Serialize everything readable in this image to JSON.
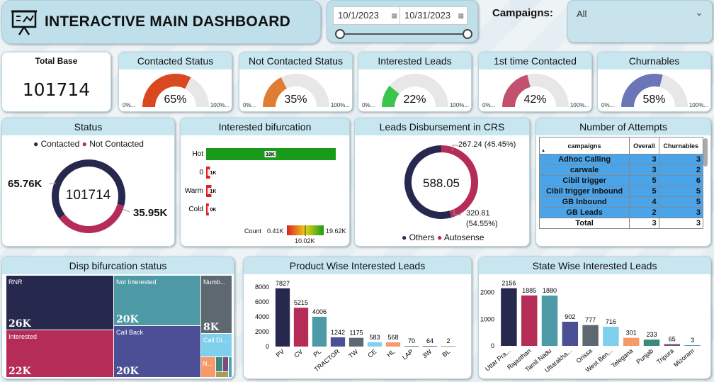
{
  "header": {
    "title": "INTERACTIVE MAIN DASHBOARD",
    "date_start": "10/1/2023",
    "date_end": "10/31/2023",
    "campaigns_label": "Campaigns:",
    "campaigns_value": "All",
    "slider_start_fraction": 0.0,
    "slider_end_fraction": 1.0
  },
  "kpis": {
    "total_base": {
      "title": "Total Base",
      "value": "101714"
    },
    "gauges": [
      {
        "title": "Contacted Status",
        "value_label": "65%",
        "value": 0.65,
        "color": "#d9481e",
        "min": "0%...",
        "max": "100%..."
      },
      {
        "title": "Not Contacted Status",
        "value_label": "35%",
        "value": 0.35,
        "color": "#e07d35",
        "min": "0%...",
        "max": "100%..."
      },
      {
        "title": "Interested Leads",
        "value_label": "22%",
        "value": 0.22,
        "color": "#3ac54b",
        "min": "0%...",
        "max": "100%..."
      },
      {
        "title": "1st time Contacted",
        "value_label": "42%",
        "value": 0.42,
        "color": "#c2506f",
        "min": "0%...",
        "max": "100%..."
      },
      {
        "title": "Churnables",
        "value_label": "58%",
        "value": 0.58,
        "color": "#6b76b6",
        "min": "0%...",
        "max": "100%..."
      }
    ]
  },
  "status": {
    "title": "Status",
    "legend": [
      "Contacted",
      "Not Contacted"
    ],
    "colors": [
      "#27284e",
      "#b52c57"
    ],
    "center": "101714",
    "left_label": "65.76K",
    "right_label": "35.95K",
    "values": [
      65.76,
      35.95
    ]
  },
  "interested_bifurcation": {
    "title": "Interested bifurcation",
    "rows": [
      {
        "label": "Hot",
        "value_label": "19K",
        "value": 19.62
      },
      {
        "label": "0",
        "value_label": "1K",
        "value": 0.6
      },
      {
        "label": "Warm",
        "value_label": "1K",
        "value": 0.8
      },
      {
        "label": "Cold",
        "value_label": "0K",
        "value": 0.41
      }
    ],
    "legend_title": "Count",
    "legend_min": "0.41K",
    "legend_mid": "10.02K",
    "legend_max": "19.62K"
  },
  "crs": {
    "title": "Leads Disbursement in CRS",
    "center": "588.05",
    "top_label": "267.24 (45.45%)",
    "bottom_label_1": "320.81",
    "bottom_label_2": "(54.55%)",
    "legend": [
      "Others",
      "Autosense"
    ],
    "colors": [
      "#27284e",
      "#b52c57"
    ],
    "values": [
      320.81,
      267.24
    ]
  },
  "attempts": {
    "title": "Number of Attempts",
    "columns": [
      "campaigns",
      "Overall",
      "Churnables"
    ],
    "rows": [
      [
        "Adhoc Calling",
        "3",
        "3"
      ],
      [
        "carwale",
        "3",
        "2"
      ],
      [
        "Cibil trigger",
        "5",
        "6"
      ],
      [
        "Cibil trigger Inbound",
        "5",
        "5"
      ],
      [
        "GB Inbound",
        "4",
        "5"
      ],
      [
        "GB Leads",
        "2",
        "3"
      ]
    ],
    "total": [
      "Total",
      "3",
      "3"
    ],
    "sort_icon": "sort-up-icon"
  },
  "disp": {
    "title": "Disp bifurcation status",
    "tiles": [
      {
        "name": "RNR",
        "value": "26K",
        "color": "#27284e"
      },
      {
        "name": "Interested",
        "value": "22K",
        "color": "#b52c57"
      },
      {
        "name": "Not Interested",
        "value": "20K",
        "color": "#4d9aa6"
      },
      {
        "name": "Call Back",
        "value": "20K",
        "color": "#4d4f96"
      },
      {
        "name": "Numb...",
        "value": "8K",
        "color": "#5d6870"
      },
      {
        "name": "Call Di...",
        "value": "",
        "color": "#7ed0ec"
      },
      {
        "name": "N...",
        "value": "",
        "color": "#f59a68"
      }
    ]
  },
  "chart_data": [
    {
      "type": "bar",
      "title": "Product Wise Interested Leads",
      "categories": [
        "PV",
        "CV",
        "PL",
        "TRACTOR",
        "TW",
        "CE",
        "HL",
        "LAP",
        "3W",
        "BL"
      ],
      "values": [
        7827,
        5215,
        4006,
        1242,
        1175,
        583,
        568,
        70,
        64,
        2
      ],
      "colors": [
        "#27284e",
        "#b52c57",
        "#4d9aa6",
        "#4d4f96",
        "#5d6870",
        "#7ed0ec",
        "#f59a68",
        "#3a8a7e",
        "#7d4b80",
        "#a99b58"
      ],
      "yticks": [
        "0",
        "2000",
        "4000",
        "6000",
        "8000"
      ],
      "ylim": [
        0,
        8000
      ],
      "xlabel": "",
      "ylabel": ""
    },
    {
      "type": "bar",
      "title": "State Wise Interested Leads",
      "categories": [
        "Uttar Pra...",
        "Rajasthan",
        "Tamil Nadu",
        "Uttarakha...",
        "Orissa",
        "West Ben...",
        "Telegana",
        "Punjab",
        "Tripura",
        "Mizoram"
      ],
      "values": [
        2156,
        1885,
        1880,
        902,
        777,
        716,
        301,
        233,
        65,
        3
      ],
      "colors": [
        "#27284e",
        "#b52c57",
        "#4d9aa6",
        "#4d4f96",
        "#5d6870",
        "#7ed0ec",
        "#f59a68",
        "#3a8a7e",
        "#7d4b80",
        "#4ca3b3"
      ],
      "yticks": [
        "0",
        "1000",
        "2000"
      ],
      "ylim": [
        0,
        2200
      ],
      "xlabel": "",
      "ylabel": ""
    }
  ]
}
